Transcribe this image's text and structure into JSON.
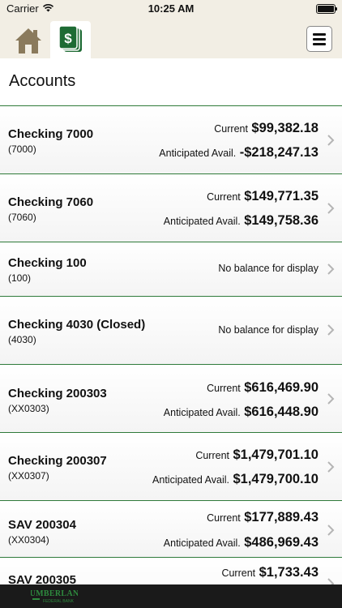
{
  "status_bar": {
    "carrier": "Carrier",
    "time": "10:25 AM",
    "icons": [
      "wifi-icon",
      "battery-icon"
    ]
  },
  "nav": {
    "icons": [
      "home-icon",
      "accounts-icon",
      "menu-icon"
    ],
    "accent_color": "#1e6b34",
    "home_color": "#8a7a5c"
  },
  "page": {
    "title": "Accounts"
  },
  "accounts": [
    {
      "name": "Checking 7000",
      "number": "(7000)",
      "current_label": "Current",
      "current_value": "$99,382.18",
      "anticipated_label": "Anticipated Avail.",
      "anticipated_value": "-$218,247.13"
    },
    {
      "name": "Checking 7060",
      "number": "(7060)",
      "current_label": "Current",
      "current_value": "$149,771.35",
      "anticipated_label": "Anticipated Avail.",
      "anticipated_value": "$149,758.36"
    },
    {
      "name": "Checking 100",
      "number": "(100)",
      "no_balance": "No balance for display"
    },
    {
      "name": "Checking 4030 (Closed)",
      "number": "(4030)",
      "no_balance": "No balance for display"
    },
    {
      "name": "Checking 200303",
      "number": "(XX0303)",
      "current_label": "Current",
      "current_value": "$616,469.90",
      "anticipated_label": "Anticipated Avail.",
      "anticipated_value": "$616,448.90"
    },
    {
      "name": "Checking 200307",
      "number": "(XX0307)",
      "current_label": "Current",
      "current_value": "$1,479,701.10",
      "anticipated_label": "Anticipated Avail.",
      "anticipated_value": "$1,479,700.10"
    },
    {
      "name": "SAV 200304",
      "number": "(XX0304)",
      "current_label": "Current",
      "current_value": "$177,889.43",
      "anticipated_label": "Anticipated Avail.",
      "anticipated_value": "$486,969.43"
    },
    {
      "name": "SAV 200305",
      "number": "",
      "current_label": "Current",
      "current_value": "$1,733.43",
      "anticipated_label": "",
      "anticipated_value": ""
    }
  ],
  "footer": {
    "logo_text": "CUMBERLAND",
    "logo_subtext": "FEDERAL BANK",
    "logo_color": "#2e8b3e"
  }
}
